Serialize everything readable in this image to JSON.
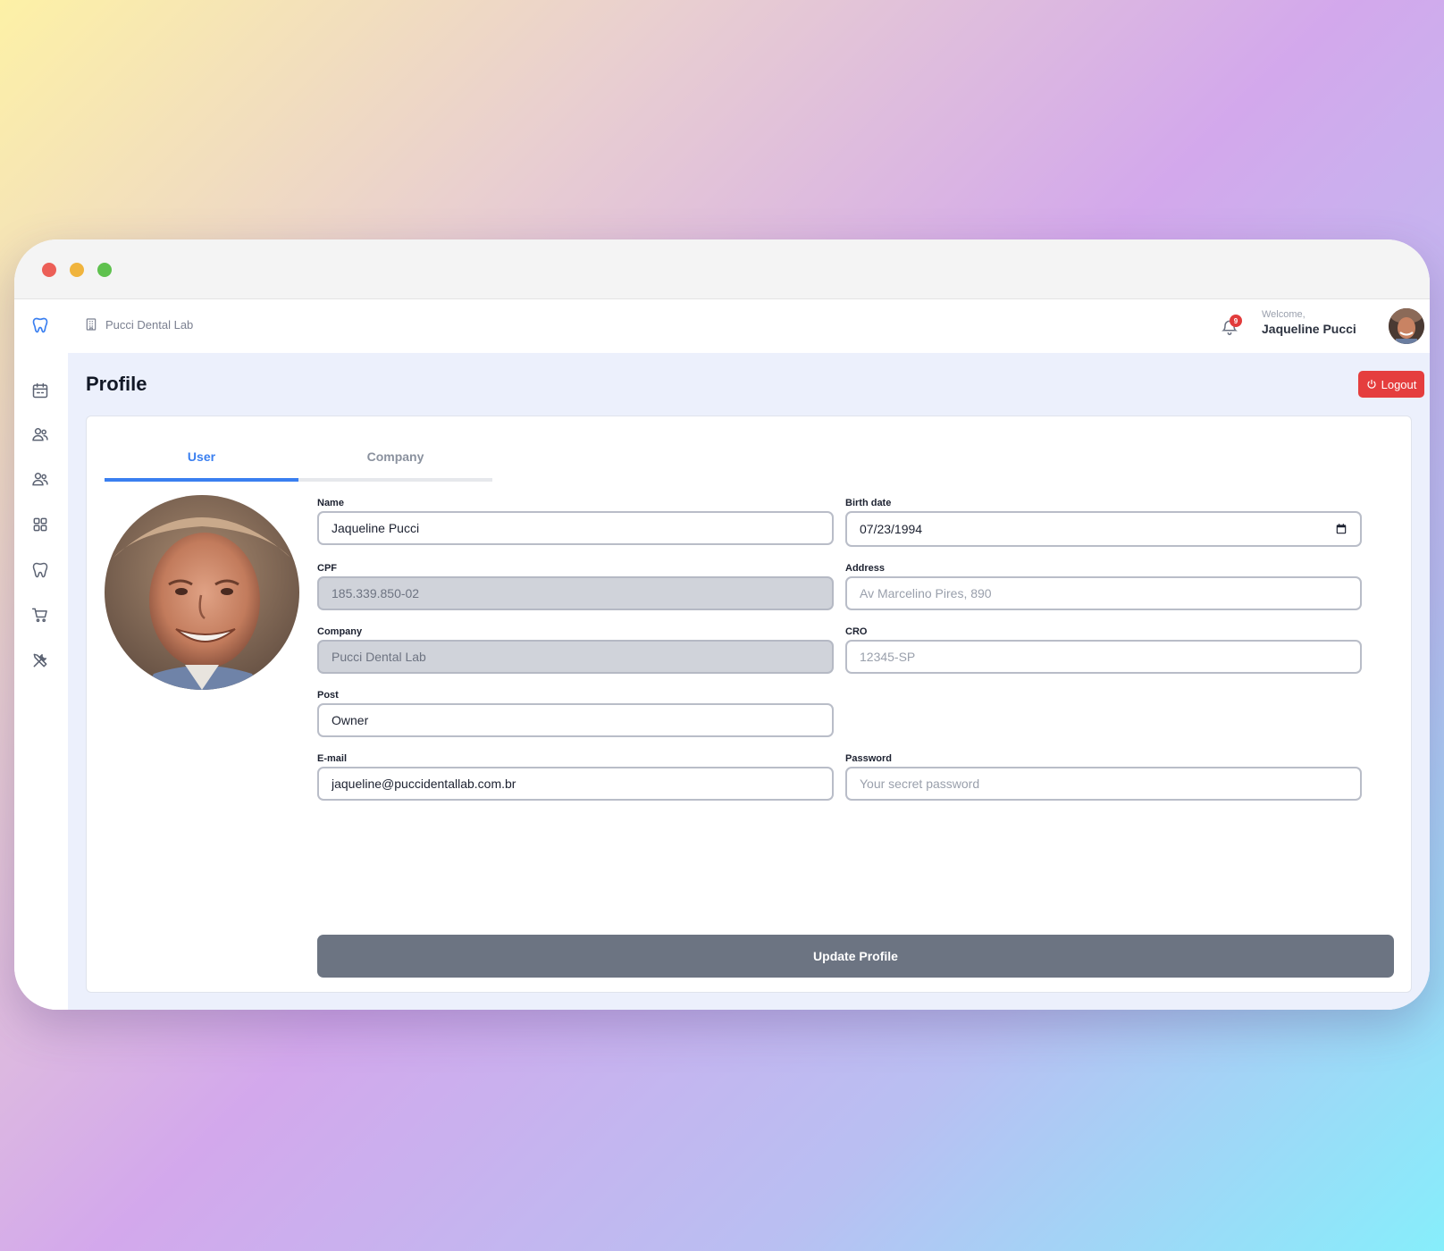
{
  "topbar": {
    "company_name": "Pucci Dental Lab",
    "notification_count": "9",
    "welcome_label": "Welcome,",
    "user_name": "Jaqueline Pucci"
  },
  "page": {
    "title": "Profile",
    "logout_label": "Logout"
  },
  "tabs": [
    {
      "label": "User",
      "active": true
    },
    {
      "label": "Company",
      "active": false
    }
  ],
  "form": {
    "name": {
      "label": "Name",
      "value": "Jaqueline Pucci"
    },
    "birth_date": {
      "label": "Birth date",
      "value": "07/23/1994"
    },
    "cpf": {
      "label": "CPF",
      "value": "185.339.850-02"
    },
    "address": {
      "label": "Address",
      "placeholder": "Av Marcelino Pires, 890"
    },
    "company": {
      "label": "Company",
      "value": "Pucci Dental Lab"
    },
    "cro": {
      "label": "CRO",
      "placeholder": "12345-SP"
    },
    "post": {
      "label": "Post",
      "value": "Owner"
    },
    "email": {
      "label": "E-mail",
      "value": "jaqueline@puccidentallab.com.br"
    },
    "password": {
      "label": "Password",
      "placeholder": "Your secret password"
    },
    "submit_label": "Update Profile"
  },
  "sidebar": {
    "items": [
      {
        "icon": "tooth-logo-icon"
      },
      {
        "icon": "calendar-icon"
      },
      {
        "icon": "users-icon"
      },
      {
        "icon": "patients-icon"
      },
      {
        "icon": "grid-icon"
      },
      {
        "icon": "tooth-icon"
      },
      {
        "icon": "cart-icon"
      },
      {
        "icon": "tools-icon"
      }
    ]
  },
  "colors": {
    "accent": "#3a7ff0",
    "danger": "#e53e3e",
    "content_bg": "#ecf0fc",
    "submit_bg": "#6c7482"
  }
}
